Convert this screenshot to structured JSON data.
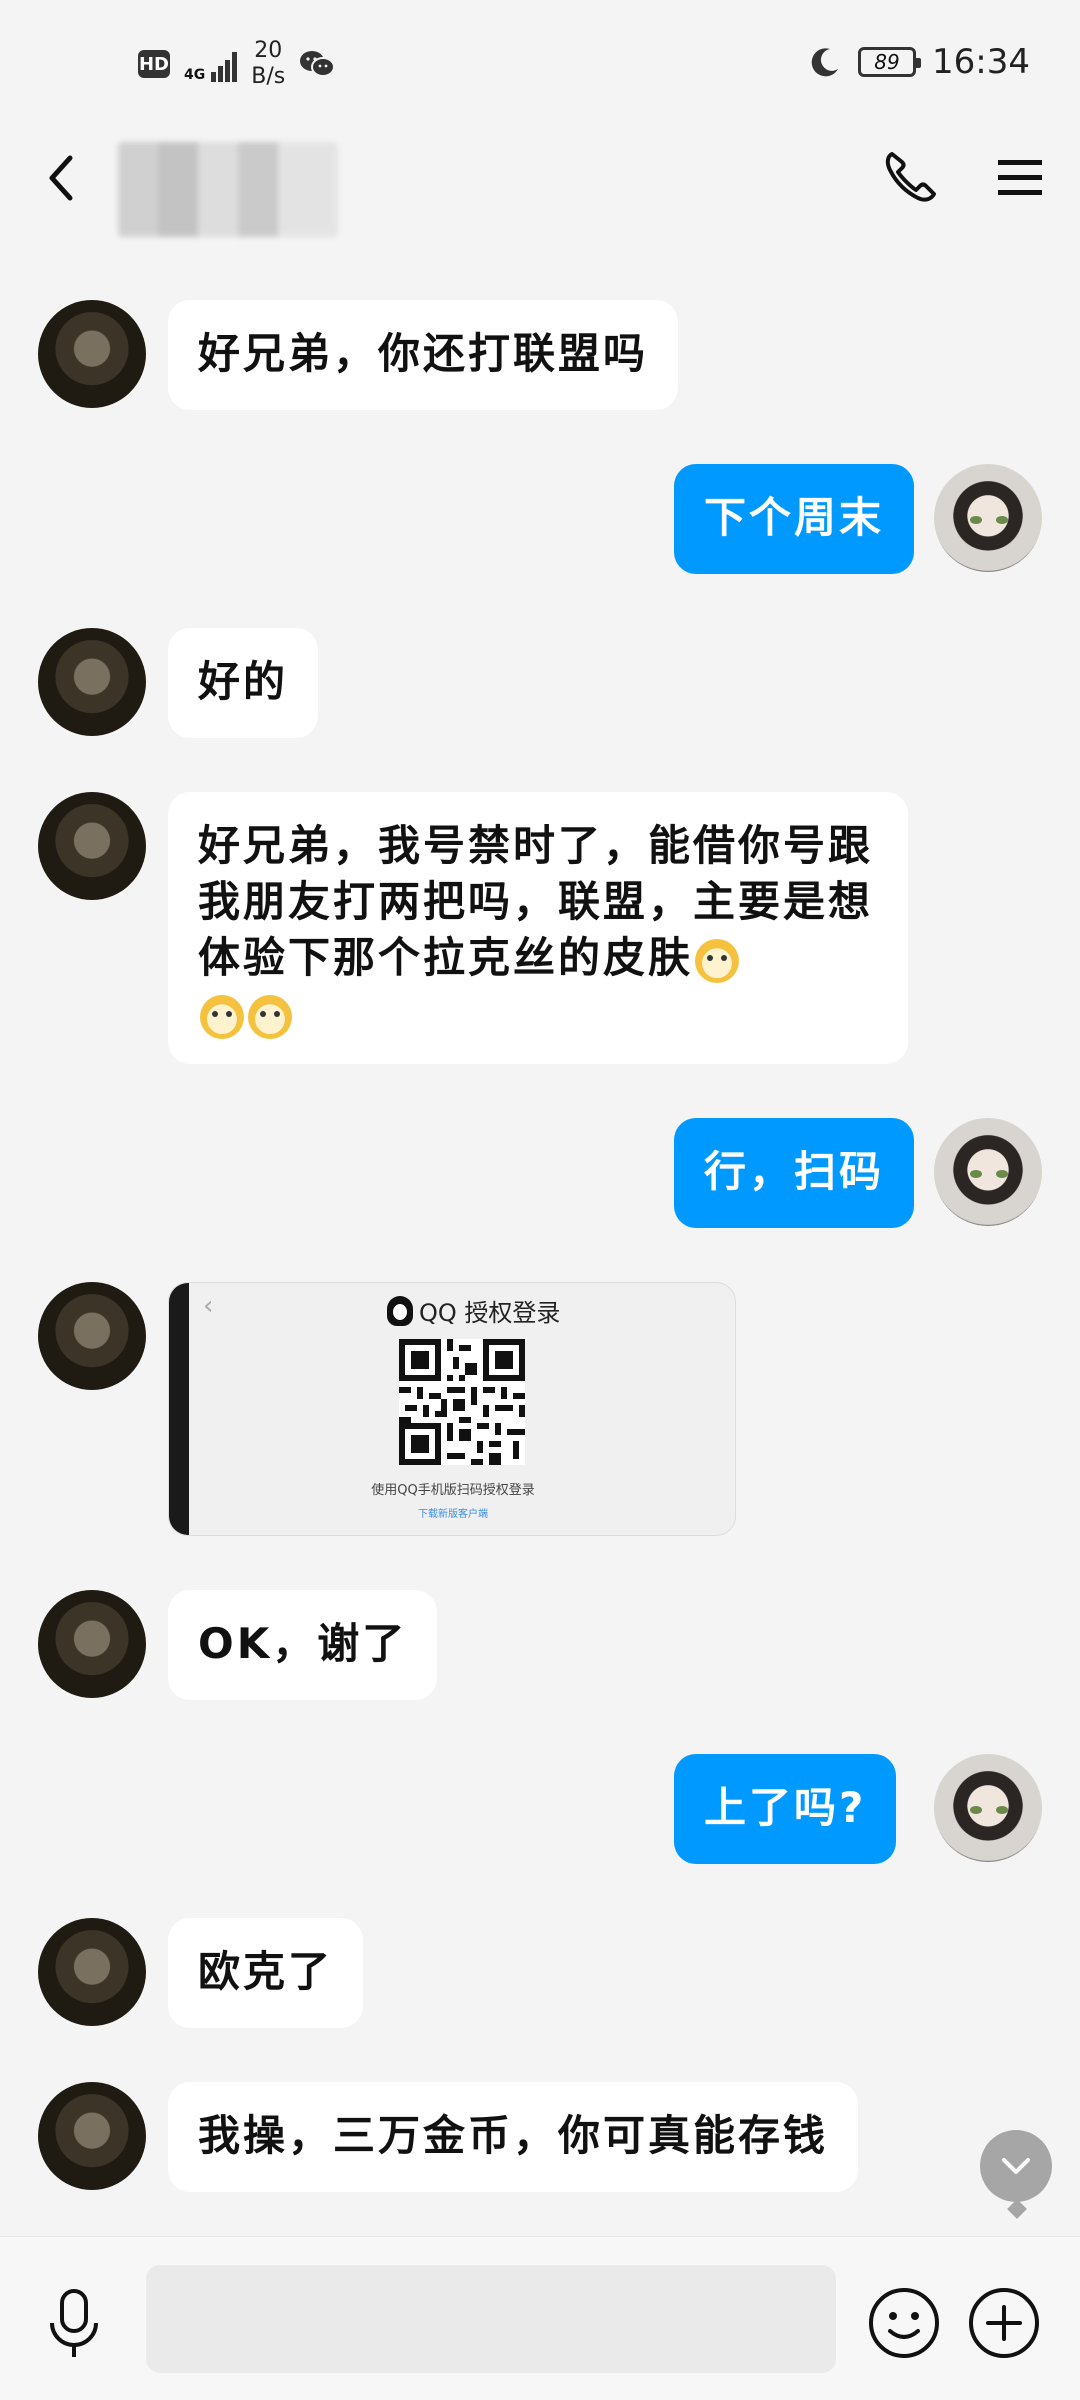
{
  "status_bar": {
    "hd": "HD",
    "network": "4G",
    "speed_value": "20",
    "speed_unit": "B/s",
    "battery": "89",
    "time": "16:34"
  },
  "header": {
    "contact_name_obscured": true
  },
  "messages": [
    {
      "side": "in",
      "text": "好兄弟，你还打联盟吗"
    },
    {
      "side": "out",
      "text": "下个周末"
    },
    {
      "side": "in",
      "text": "好的"
    },
    {
      "side": "in",
      "text": "好兄弟，我号禁时了，能借你号跟我朋友打两把吗，联盟，主要是想体验下那个拉克丝的皮肤",
      "emoji_count": 3
    },
    {
      "side": "out",
      "text": "行，扫码"
    },
    {
      "side": "in",
      "type": "image",
      "card_title": "QQ 授权登录",
      "card_hint": "使用QQ手机版扫码授权登录",
      "card_link": "下载新版客户端"
    },
    {
      "side": "in",
      "text": "OK，谢了"
    },
    {
      "side": "out",
      "text": "上了吗?"
    },
    {
      "side": "in",
      "text": "欧克了"
    },
    {
      "side": "in",
      "text": "我操，三万金币，你可真能存钱"
    }
  ],
  "input": {
    "placeholder": ""
  },
  "colors": {
    "background": "#f4f4f4",
    "outgoing_bubble": "#0099ff",
    "incoming_bubble": "#ffffff"
  },
  "icons": [
    "back-icon",
    "phone-icon",
    "menu-icon",
    "mic-icon",
    "emoji-icon",
    "plus-icon",
    "chevron-down-icon"
  ]
}
